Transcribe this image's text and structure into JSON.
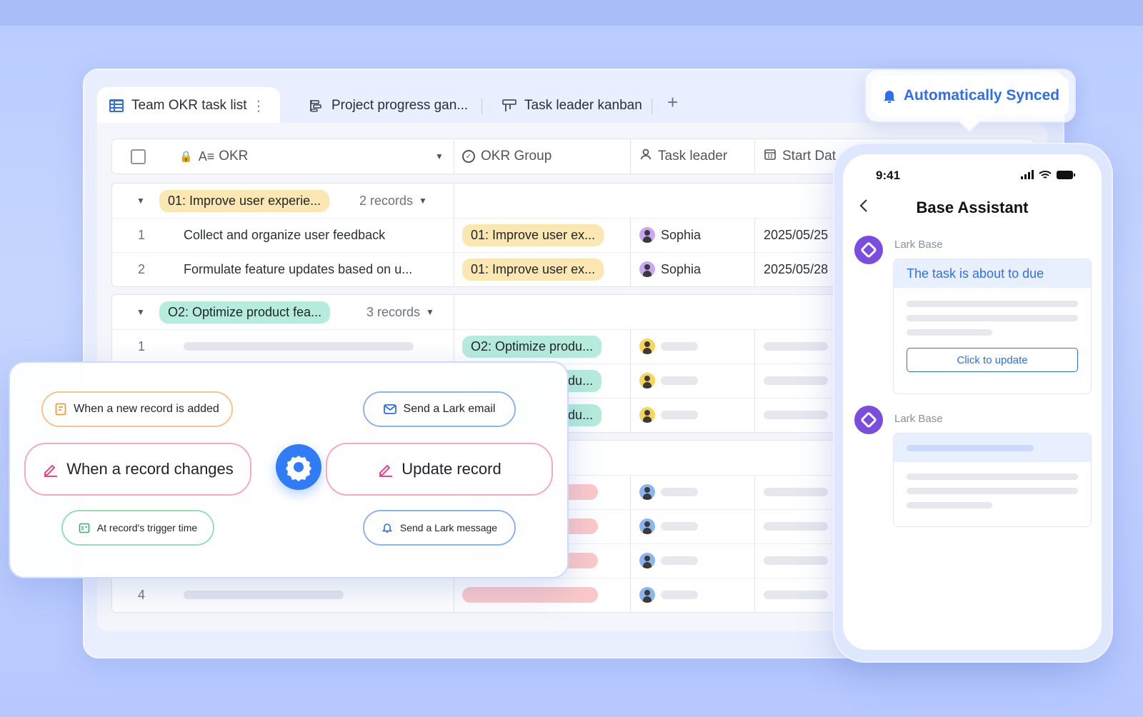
{
  "tabs": {
    "active": "Team OKR task list",
    "second": "Project progress gan...",
    "third": "Task leader kanban",
    "add": "+"
  },
  "columns": {
    "okr": "OKR",
    "group": "OKR Group",
    "leader": "Task leader",
    "start": "Start Dat"
  },
  "group1": {
    "tag": "01: Improve user experie...",
    "records": "2 records",
    "rows": [
      {
        "num": "1",
        "task": "Collect and organize user feedback",
        "group": "01: Improve user ex...",
        "leader": "Sophia",
        "date": "2025/05/25"
      },
      {
        "num": "2",
        "task": "Formulate feature updates based on u...",
        "group": "01: Improve user ex...",
        "leader": "Sophia",
        "date": "2025/05/28"
      }
    ]
  },
  "group2": {
    "tag": "O2: Optimize product fea...",
    "records": "3 records",
    "row1_num": "1",
    "row1_group": "O2: Optimize produ...",
    "row2_group_tail": "du...",
    "row3_group_tail": "du..."
  },
  "group3": {
    "last_num": "4"
  },
  "automation": {
    "trigger_new": "When a new record is added",
    "trigger_change": "When a record changes",
    "trigger_time": "At record's trigger time",
    "action_email": "Send a Lark email",
    "action_update": "Update record",
    "action_message": "Send a Lark message"
  },
  "synced_label": "Automatically Synced",
  "phone": {
    "time": "9:41",
    "title": "Base Assistant",
    "sender1": "Lark Base",
    "msg1_title": "The task is about to due",
    "msg1_button": "Click to update",
    "sender2": "Lark Base"
  },
  "colors": {
    "accent": "#2f6ef0",
    "yellow_tag": "#fbe7b2",
    "teal_tag": "#b6ecdd",
    "pink_tag": "#fbc9c9",
    "bot": "#7a4ddf"
  }
}
